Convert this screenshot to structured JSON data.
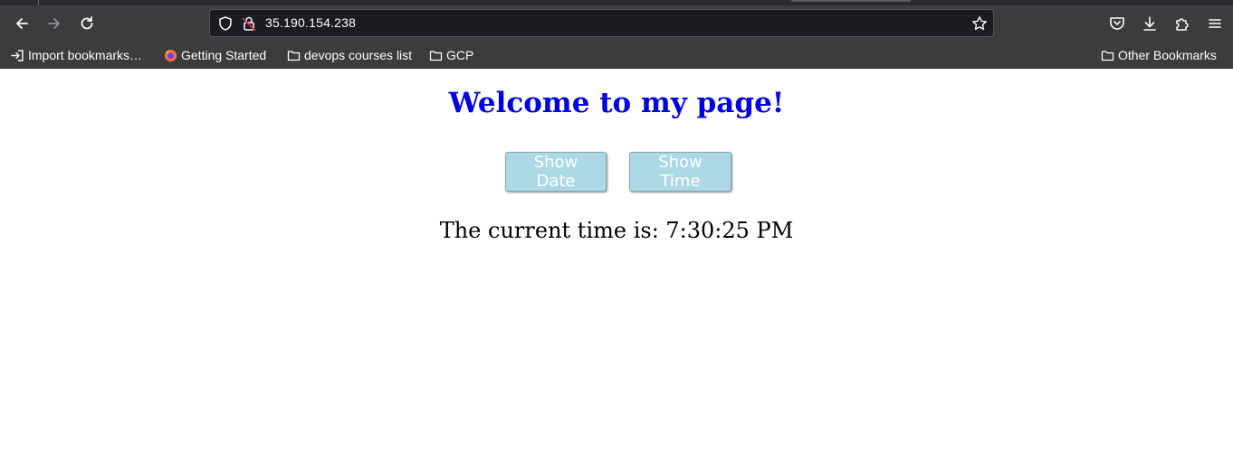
{
  "browser": {
    "url": "35.190.154.238",
    "bookmarks": [
      {
        "label": "Import bookmarks…",
        "icon": "import-icon"
      },
      {
        "label": "Getting Started",
        "icon": "firefox-icon"
      },
      {
        "label": "devops courses list",
        "icon": "folder-icon"
      },
      {
        "label": "GCP",
        "icon": "folder-icon"
      }
    ],
    "other_bookmarks": "Other Bookmarks"
  },
  "page": {
    "title": "Welcome to my page!",
    "buttons": {
      "show_date": "Show Date",
      "show_time": "Show Time"
    },
    "time_text": "The current time is: 7:30:25 PM"
  },
  "colors": {
    "title": "#0000e6",
    "button_bg": "#add8e6",
    "button_text": "#ffffff",
    "chrome_bg": "#3c3c3c"
  }
}
